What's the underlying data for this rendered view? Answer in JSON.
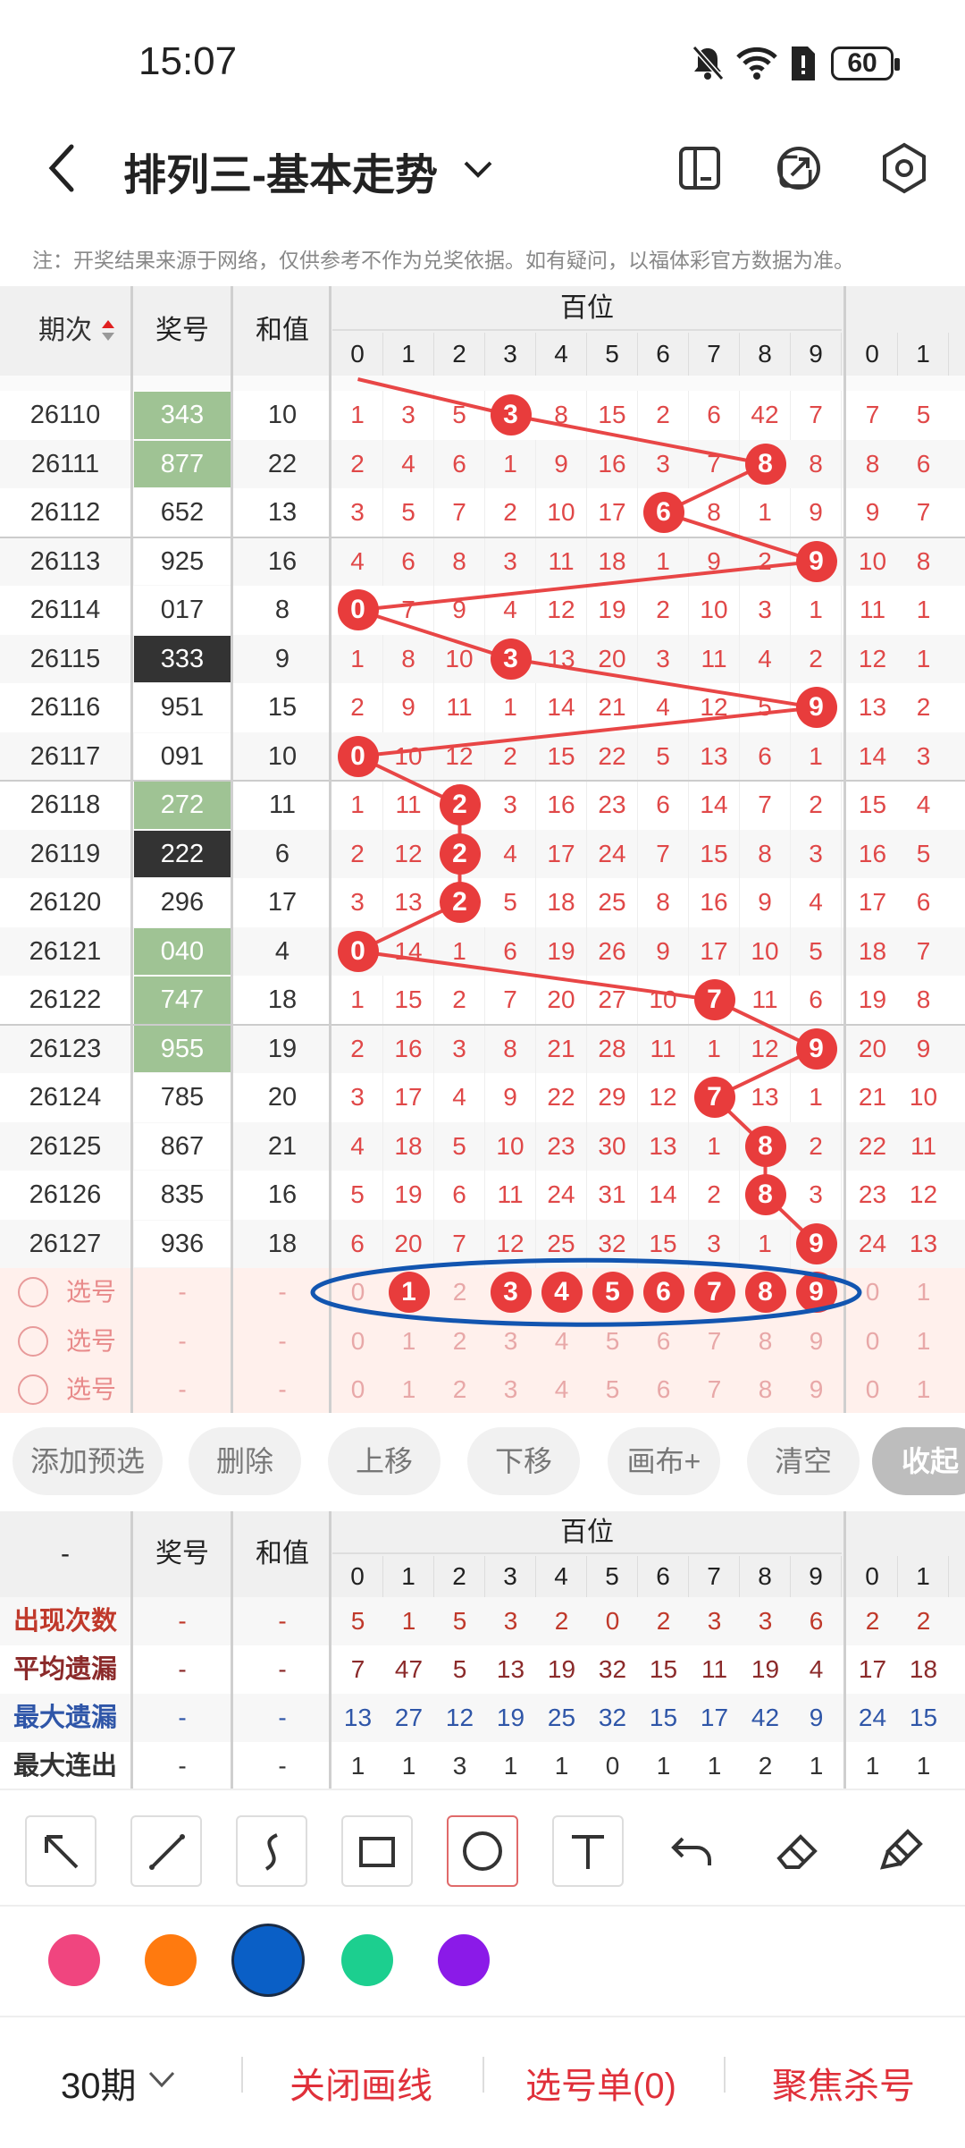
{
  "status": {
    "time": "15:07",
    "battery": "60"
  },
  "header": {
    "title": "排列三-基本走势"
  },
  "note": "注：开奖结果来源于网络，仅供参考不作为兑奖依据。如有疑问，以福体彩官方数据为准。",
  "table": {
    "col_period": "期次",
    "col_number": "奖号",
    "col_sum": "和值",
    "col_group": "百位",
    "digits": [
      "0",
      "1",
      "2",
      "3",
      "4",
      "5",
      "6",
      "7",
      "8",
      "9"
    ],
    "extra_digits": [
      "0",
      "1"
    ],
    "rows": [
      {
        "p": "26110",
        "n": "343",
        "s": "10",
        "v": [
          "1",
          "3",
          "5",
          "3",
          "8",
          "15",
          "2",
          "6",
          "42",
          "7"
        ],
        "x": [
          "7",
          "5"
        ],
        "hit": 3,
        "tag": "green"
      },
      {
        "p": "26111",
        "n": "877",
        "s": "22",
        "v": [
          "2",
          "4",
          "6",
          "1",
          "9",
          "16",
          "3",
          "7",
          "8",
          "8"
        ],
        "x": [
          "8",
          "6"
        ],
        "hit": 8,
        "tag": "green"
      },
      {
        "p": "26112",
        "n": "652",
        "s": "13",
        "v": [
          "3",
          "5",
          "7",
          "2",
          "10",
          "17",
          "6",
          "8",
          "1",
          "9"
        ],
        "x": [
          "9",
          "7"
        ],
        "hit": 6,
        "tag": ""
      },
      {
        "p": "26113",
        "n": "925",
        "s": "16",
        "v": [
          "4",
          "6",
          "8",
          "3",
          "11",
          "18",
          "1",
          "9",
          "2",
          "9"
        ],
        "x": [
          "10",
          "8"
        ],
        "hit": 9,
        "tag": ""
      },
      {
        "p": "26114",
        "n": "017",
        "s": "8",
        "v": [
          "0",
          "7",
          "9",
          "4",
          "12",
          "19",
          "2",
          "10",
          "3",
          "1"
        ],
        "x": [
          "11",
          "1"
        ],
        "hit": 0,
        "tag": ""
      },
      {
        "p": "26115",
        "n": "333",
        "s": "9",
        "v": [
          "1",
          "8",
          "10",
          "3",
          "13",
          "20",
          "3",
          "11",
          "4",
          "2"
        ],
        "x": [
          "12",
          "1"
        ],
        "hit": 3,
        "tag": "dark"
      },
      {
        "p": "26116",
        "n": "951",
        "s": "15",
        "v": [
          "2",
          "9",
          "11",
          "1",
          "14",
          "21",
          "4",
          "12",
          "5",
          "9"
        ],
        "x": [
          "13",
          "2"
        ],
        "hit": 9,
        "tag": ""
      },
      {
        "p": "26117",
        "n": "091",
        "s": "10",
        "v": [
          "0",
          "10",
          "12",
          "2",
          "15",
          "22",
          "5",
          "13",
          "6",
          "1"
        ],
        "x": [
          "14",
          "3"
        ],
        "hit": 0,
        "tag": ""
      },
      {
        "p": "26118",
        "n": "272",
        "s": "11",
        "v": [
          "1",
          "11",
          "2",
          "3",
          "16",
          "23",
          "6",
          "14",
          "7",
          "2"
        ],
        "x": [
          "15",
          "4"
        ],
        "hit": 2,
        "tag": "green"
      },
      {
        "p": "26119",
        "n": "222",
        "s": "6",
        "v": [
          "2",
          "12",
          "2",
          "4",
          "17",
          "24",
          "7",
          "15",
          "8",
          "3"
        ],
        "x": [
          "16",
          "5"
        ],
        "hit": 2,
        "tag": "dark"
      },
      {
        "p": "26120",
        "n": "296",
        "s": "17",
        "v": [
          "3",
          "13",
          "2",
          "5",
          "18",
          "25",
          "8",
          "16",
          "9",
          "4"
        ],
        "x": [
          "17",
          "6"
        ],
        "hit": 2,
        "tag": ""
      },
      {
        "p": "26121",
        "n": "040",
        "s": "4",
        "v": [
          "0",
          "14",
          "1",
          "6",
          "19",
          "26",
          "9",
          "17",
          "10",
          "5"
        ],
        "x": [
          "18",
          "7"
        ],
        "hit": 0,
        "tag": "green"
      },
      {
        "p": "26122",
        "n": "747",
        "s": "18",
        "v": [
          "1",
          "15",
          "2",
          "7",
          "20",
          "27",
          "10",
          "7",
          "11",
          "6"
        ],
        "x": [
          "19",
          "8"
        ],
        "hit": 7,
        "tag": "green"
      },
      {
        "p": "26123",
        "n": "955",
        "s": "19",
        "v": [
          "2",
          "16",
          "3",
          "8",
          "21",
          "28",
          "11",
          "1",
          "12",
          "9"
        ],
        "x": [
          "20",
          "9"
        ],
        "hit": 9,
        "tag": "green"
      },
      {
        "p": "26124",
        "n": "785",
        "s": "20",
        "v": [
          "3",
          "17",
          "4",
          "9",
          "22",
          "29",
          "12",
          "7",
          "13",
          "1"
        ],
        "x": [
          "21",
          "10"
        ],
        "hit": 7,
        "tag": ""
      },
      {
        "p": "26125",
        "n": "867",
        "s": "21",
        "v": [
          "4",
          "18",
          "5",
          "10",
          "23",
          "30",
          "13",
          "1",
          "8",
          "2"
        ],
        "x": [
          "22",
          "11"
        ],
        "hit": 8,
        "tag": ""
      },
      {
        "p": "26126",
        "n": "835",
        "s": "16",
        "v": [
          "5",
          "19",
          "6",
          "11",
          "24",
          "31",
          "14",
          "2",
          "8",
          "3"
        ],
        "x": [
          "23",
          "12"
        ],
        "hit": 8,
        "tag": ""
      },
      {
        "p": "26127",
        "n": "936",
        "s": "18",
        "v": [
          "6",
          "20",
          "7",
          "12",
          "25",
          "32",
          "15",
          "3",
          "1",
          "9"
        ],
        "x": [
          "24",
          "13"
        ],
        "hit": 9,
        "tag": ""
      }
    ],
    "pick_label": "选号",
    "dash": "-",
    "pick_row1_selected": [
      "1",
      "3",
      "4",
      "5",
      "6",
      "7",
      "8",
      "9"
    ]
  },
  "buttons": [
    "添加预选",
    "删除",
    "上移",
    "下移",
    "画布+",
    "清空",
    "收起"
  ],
  "stats": {
    "col_first": "-",
    "rows": [
      {
        "label": "出现次数",
        "v": [
          "5",
          "1",
          "5",
          "3",
          "2",
          "0",
          "2",
          "3",
          "3",
          "6"
        ],
        "x": [
          "2",
          "2"
        ],
        "color": "#c0392b"
      },
      {
        "label": "平均遗漏",
        "v": [
          "7",
          "47",
          "5",
          "13",
          "19",
          "32",
          "15",
          "11",
          "19",
          "4"
        ],
        "x": [
          "17",
          "18"
        ],
        "color": "#8b2a2a"
      },
      {
        "label": "最大遗漏",
        "v": [
          "13",
          "27",
          "12",
          "19",
          "25",
          "32",
          "15",
          "17",
          "42",
          "9"
        ],
        "x": [
          "24",
          "15"
        ],
        "color": "#2f56a8"
      },
      {
        "label": "最大连出",
        "v": [
          "1",
          "1",
          "3",
          "1",
          "1",
          "0",
          "1",
          "1",
          "2",
          "1"
        ],
        "x": [
          "1",
          "1"
        ],
        "color": "#333"
      }
    ]
  },
  "tools": [
    "arrow-tool",
    "line-tool",
    "curve-tool",
    "rect-tool",
    "circle-tool",
    "text-tool",
    "undo-tool",
    "eraser-tool",
    "clear-tool"
  ],
  "palette": [
    "#f0457f",
    "#ff7a0f",
    "#0a5fc6",
    "#1ccf8f",
    "#8b1ae8"
  ],
  "bottom": {
    "period": "30期",
    "close_line": "关闭画线",
    "pick_list": "选号单(0)",
    "focus_kill": "聚焦杀号"
  }
}
